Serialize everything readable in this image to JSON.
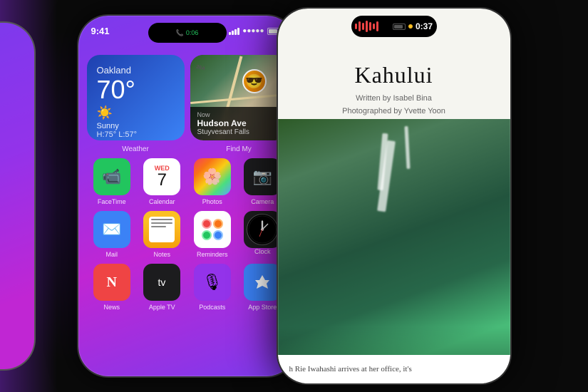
{
  "background": {
    "color": "#0a0a0a"
  },
  "left_decoration": {
    "visible": true
  },
  "phone_left": {
    "status_bar": {
      "time": "9:41",
      "call_duration": "0:06",
      "signal": "bars",
      "wifi": "dots",
      "battery": "full"
    },
    "widgets": [
      {
        "type": "weather",
        "label": "Weather",
        "city": "Oakland",
        "temperature": "70°",
        "condition": "Sunny",
        "high": "75°",
        "low": "57°"
      },
      {
        "type": "find_my",
        "label": "Find My",
        "time": "Now",
        "street": "Hudson Ave",
        "city": "Stuyvesant Falls"
      }
    ],
    "app_rows": [
      [
        {
          "id": "facetime",
          "label": "FaceTime",
          "icon": "📹",
          "bg": "facetime"
        },
        {
          "id": "calendar",
          "label": "Calendar",
          "icon": "calendar",
          "bg": "calendar",
          "day": "WED",
          "date": "7"
        },
        {
          "id": "photos",
          "label": "Photos",
          "icon": "🌸",
          "bg": "photos"
        },
        {
          "id": "camera",
          "label": "Camera",
          "icon": "📷",
          "bg": "camera"
        }
      ],
      [
        {
          "id": "mail",
          "label": "Mail",
          "icon": "✉️",
          "bg": "mail"
        },
        {
          "id": "notes",
          "label": "Notes",
          "icon": "📝",
          "bg": "notes"
        },
        {
          "id": "reminders",
          "label": "Reminders",
          "icon": "⭕",
          "bg": "reminders"
        },
        {
          "id": "clock",
          "label": "Clock",
          "icon": "🕐",
          "bg": "clock"
        }
      ],
      [
        {
          "id": "news",
          "label": "News",
          "icon": "N",
          "bg": "news"
        },
        {
          "id": "appletv",
          "label": "Apple TV",
          "icon": "📺",
          "bg": "appletv"
        },
        {
          "id": "podcasts",
          "label": "Podcasts",
          "icon": "🎙",
          "bg": "podcasts"
        },
        {
          "id": "appstore",
          "label": "App Store",
          "icon": "A",
          "bg": "appstore"
        }
      ]
    ]
  },
  "phone_right": {
    "status_bar": {
      "recording": true,
      "timer": "0:37"
    },
    "article": {
      "title": "Kahului",
      "byline_line1": "Written by Isabel Bina",
      "byline_line2": "Photographed by Yvette Yoon",
      "footer_text": "h Rie Iwahashi arrives at her office, it's"
    }
  }
}
